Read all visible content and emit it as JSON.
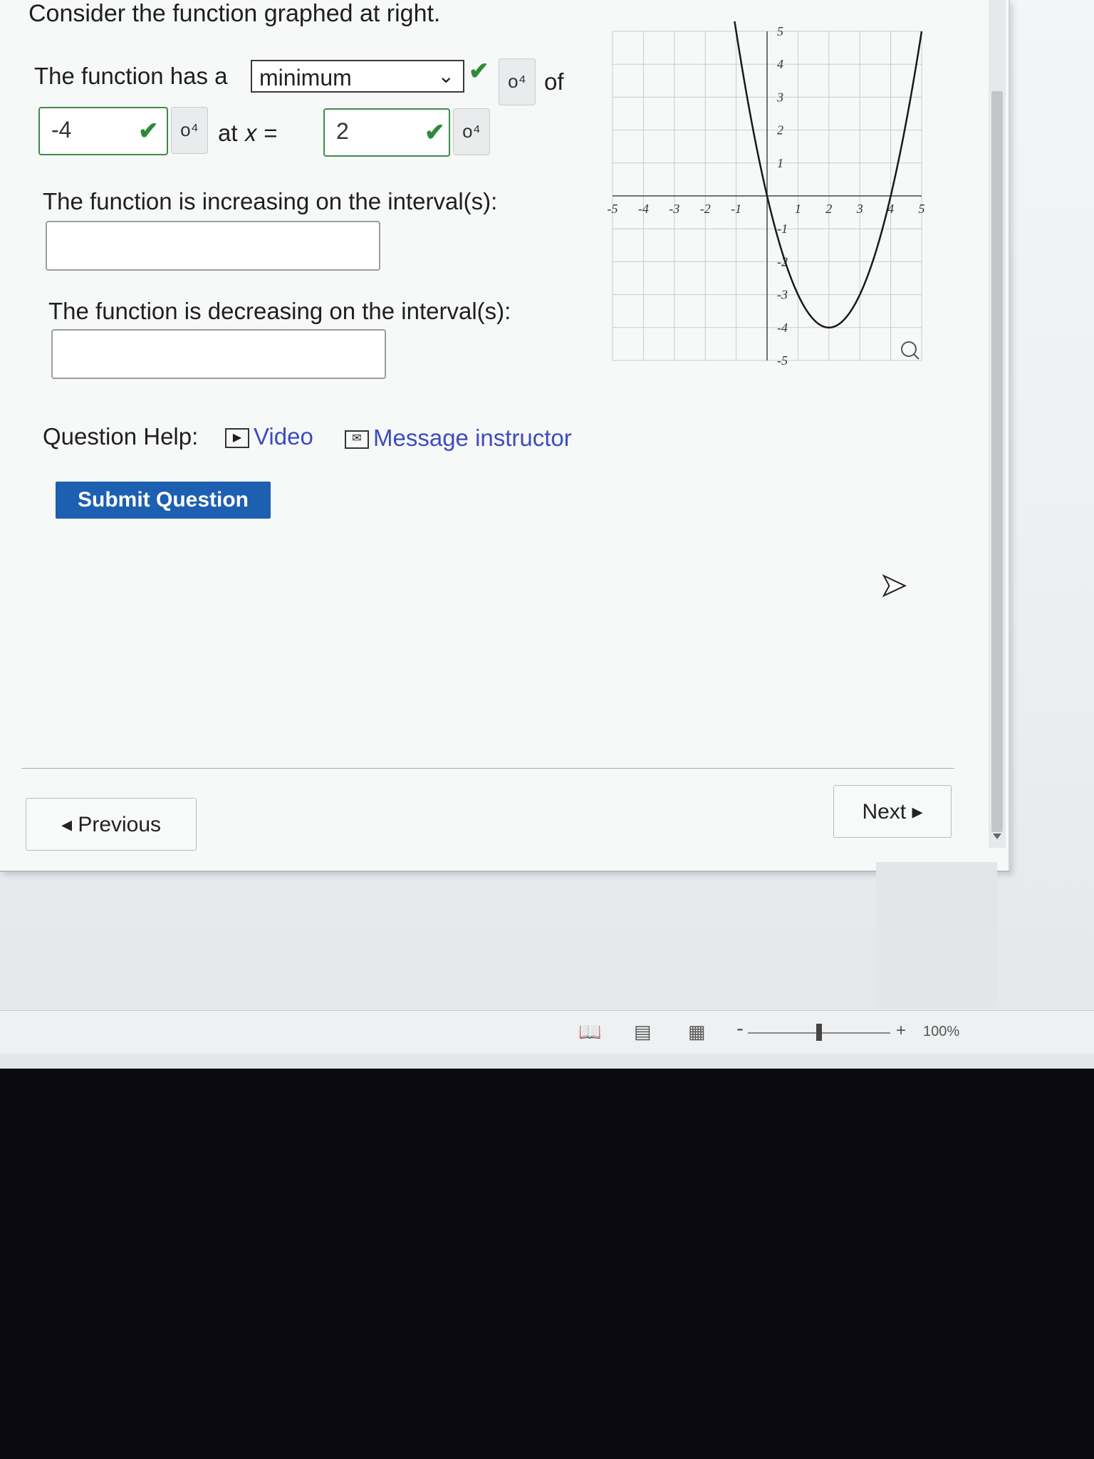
{
  "question": {
    "intro": "Consider the function graphed at right.",
    "line1_prefix": "The function has a",
    "extremum_select_value": "minimum",
    "line1_suffix": "of",
    "extremum_value": "-4",
    "at_x_label": "at 𝑥 =",
    "x_value": "2",
    "increasing_label": "The function is increasing on the interval(s):",
    "increasing_value": "",
    "decreasing_label": "The function is decreasing on the interval(s):",
    "decreasing_value": ""
  },
  "help": {
    "label": "Question Help:",
    "video": "Video",
    "message": "Message instructor"
  },
  "submit_label": "Submit Question",
  "nav": {
    "previous": "◂ Previous",
    "next": "Next ▸"
  },
  "graph": {
    "x_ticks": [
      "-5",
      "-4",
      "-3",
      "-2",
      "-1",
      "1",
      "2",
      "3",
      "4",
      "5"
    ],
    "y_ticks": [
      "5",
      "4",
      "3",
      "2",
      "1",
      "-1",
      "-2",
      "-3",
      "-4",
      "-5"
    ],
    "xlim": [
      -5,
      5
    ],
    "ylim": [
      -5,
      5
    ],
    "curve": "parabola",
    "vertex": [
      2,
      -4
    ],
    "x_intercepts": [
      0,
      4
    ],
    "color": "#1a1a1a"
  },
  "statusbar": {
    "zoom_minus": "-",
    "zoom_plus": "+",
    "zoom_level": "100%"
  },
  "icons": {
    "check": "✔",
    "key": "o⁴"
  }
}
